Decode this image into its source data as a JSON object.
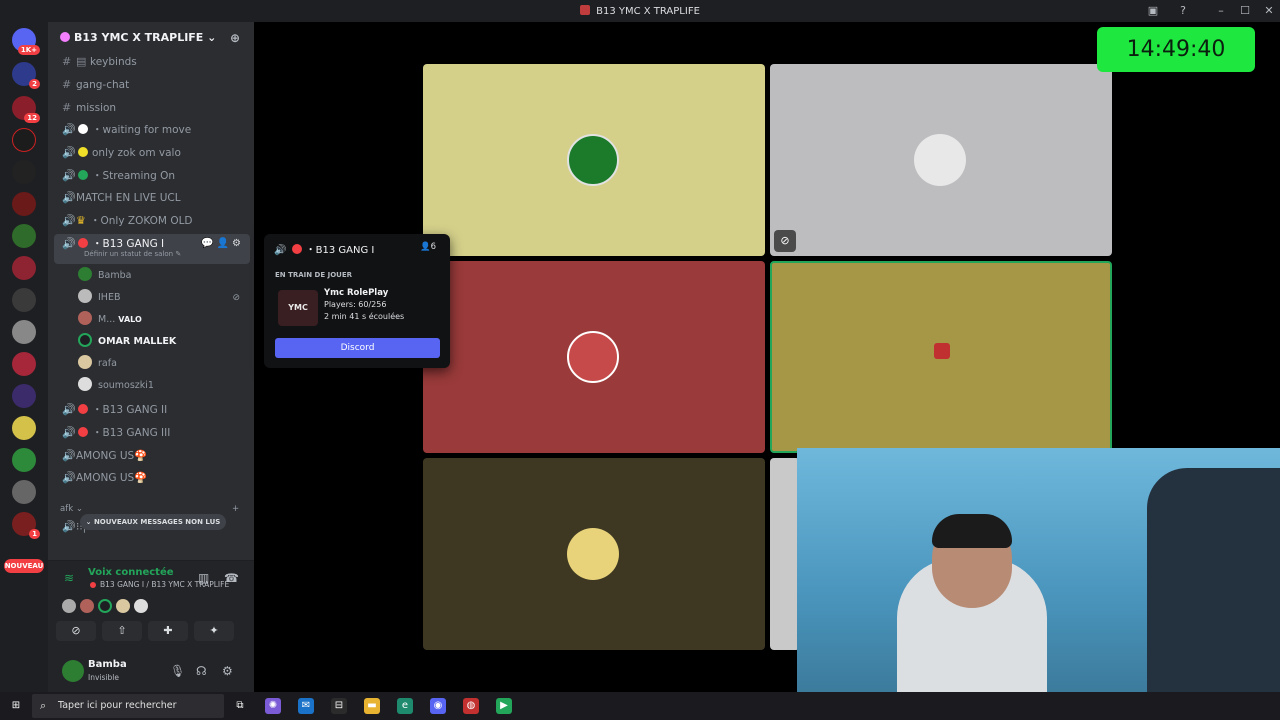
{
  "window": {
    "title": "B13 YMC X TRAPLIFE"
  },
  "rail": {
    "badges": [
      "1K+",
      "2",
      "12",
      "1"
    ],
    "nouveau": "NOUVEAU"
  },
  "server": {
    "name": "B13 YMC X TRAPLIFE ⌄"
  },
  "channels": {
    "keybinds": "keybinds",
    "gang_chat": "gang-chat",
    "mission": "mission",
    "waiting": "・waiting for move",
    "valo": "only zok om valo",
    "streaming": "・Streaming On",
    "match": "MATCH EN LIVE UCL",
    "zokom": "・Only ZOKOM OLD",
    "gang1": "・B13 GANG I",
    "gang1_sub": "Définir un statut de salon ✎",
    "gang2": "・B13 GANG II",
    "gang3": "・B13 GANG III",
    "among1": "AMONG US🍄",
    "among2": "AMONG US🍄",
    "afk_cat": "afk ⌄",
    "afk": "⁝⁝| AFK"
  },
  "members": [
    {
      "name": "Bamba",
      "tag": ""
    },
    {
      "name": "IHEB",
      "tag": ""
    },
    {
      "name": "M...",
      "tag": "VALO"
    },
    {
      "name": "OMAR MALLEK",
      "tag": ""
    },
    {
      "name": "rafa",
      "tag": ""
    },
    {
      "name": "soumoszki1",
      "tag": ""
    }
  ],
  "unread_pill": "⌄ NOUVEAUX MESSAGES NON LUS",
  "voice": {
    "status": "Voix connectée",
    "channel": "B13 GANG I / B13 YMC X TRAPLIFE"
  },
  "user": {
    "name": "Bamba",
    "status": "Invisible"
  },
  "popup": {
    "title": "・B13 GANG I",
    "count": "6",
    "section": "EN TRAIN DE JOUER",
    "game": "Ymc RolePlay",
    "players": "Players: 60/256",
    "elapsed": "2 min 41 s écoulées",
    "logo_text": "YMC ROLEPLAY",
    "button": "Discord"
  },
  "clock": "14:49:40",
  "taskbar": {
    "search_placeholder": "Taper ici pour rechercher"
  },
  "colors": {
    "accent": "#5865f2",
    "online": "#23a55a",
    "danger": "#f23f43",
    "clock_bg": "#1ee840"
  }
}
